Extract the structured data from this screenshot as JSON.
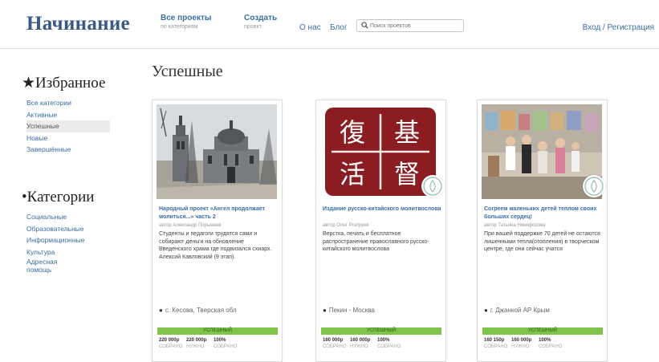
{
  "header": {
    "logo": "Начинание",
    "nav": [
      {
        "main": "Все проекты",
        "sub": "по категориям"
      },
      {
        "main": "Создать",
        "sub": "проект"
      }
    ],
    "about": "О нас",
    "blog": "Блог",
    "search_placeholder": "Поиск проектов",
    "login": "Вход / Регистрация"
  },
  "sidebar": {
    "favorites_title": "Избранное",
    "favorites": [
      "Все категории",
      "Активные",
      "Успешные",
      "Новые",
      "Завершённые"
    ],
    "categories_title": "Категории",
    "categories": [
      "Социальные",
      "Образовательные",
      "Информационные",
      "Культура",
      "Адресная помощь"
    ]
  },
  "main": {
    "section_title": "Успешные",
    "cards": [
      {
        "title": "Народный проект «Ангел продолжает молиться...» часть 2",
        "author": "автор Александр Порываев",
        "desc": "Студенты и педагоги трудятся сами и собирают деньги на обновление Введенского храма где подвизался схиарх. Алексий Кавловский (9 этап).",
        "location": "с. Кесова, Тверская обл",
        "status": "УСПЕШНЫЙ",
        "stats": [
          {
            "value": "220 000р",
            "label": "СОБРАНО"
          },
          {
            "value": "220 000р",
            "label": "НУЖНО"
          },
          {
            "value": "100%",
            "label": "СОБРАНО"
          }
        ]
      },
      {
        "title": "Издание русско-китайского молитвослова",
        "author": "автор Олег Розгруев",
        "desc": "Верстка, печать и бесплатное распространение православного русско-китайского молитвослова",
        "location": "Пекин - Москва",
        "status": "УСПЕШНЫЙ",
        "stats": [
          {
            "value": "160 000р",
            "label": "СОБРАНО"
          },
          {
            "value": "160 000р",
            "label": "НУЖНО"
          },
          {
            "value": "100%",
            "label": "СОБРАНО"
          }
        ]
      },
      {
        "title": "Согреем маленьких детей теплом своих больших сердец!",
        "author": "автор Татьяна Никифорова",
        "desc": "При вашей поддержке 70 детей не остаются лишенными тепла(отопления) в творческом центре, где они сейчас учатся",
        "location": "г. Джанкой АР Крым",
        "status": "УСПЕШНЫЙ",
        "stats": [
          {
            "value": "160 150р",
            "label": "СОБРАНО"
          },
          {
            "value": "160 000р",
            "label": "НУЖНО"
          },
          {
            "value": "100%",
            "label": "СОБРАНО"
          }
        ]
      }
    ],
    "card2_characters": [
      "復",
      "基",
      "活",
      "督"
    ]
  },
  "colors": {
    "brand": "#3a5a86",
    "link": "#3a6ea5",
    "success_bar": "#7ec34a",
    "card2_bg": "#8b1c22"
  }
}
